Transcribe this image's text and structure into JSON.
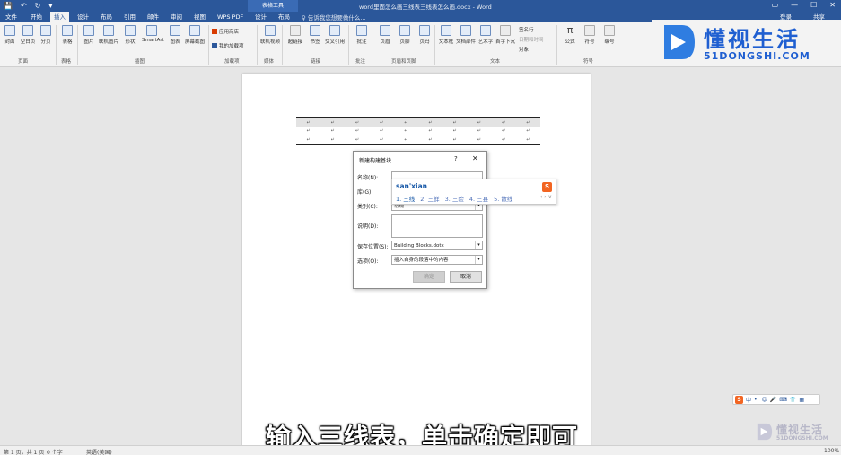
{
  "titlebar": {
    "quick_access": [
      "💾",
      "↶",
      "↻",
      "▾"
    ],
    "context_tab": "表格工具",
    "document_title": "word里面怎么画三线表三线表怎么画.docx - Word",
    "window_buttons": [
      "▭",
      "—",
      "☐",
      "✕"
    ]
  },
  "tabs": {
    "items": [
      "文件",
      "开始",
      "插入",
      "设计",
      "布局",
      "引用",
      "邮件",
      "审阅",
      "视图",
      "WPS PDF",
      "设计",
      "布局"
    ],
    "active_index": 2,
    "tell_me": "♀ 告诉我您想要做什么...",
    "user": "登录",
    "share": "共享"
  },
  "ribbon": {
    "buttons": [
      "封面",
      "空白页",
      "分页",
      "表格",
      "图片",
      "联机图片",
      "形状",
      "SmartArt",
      "图表",
      "屏幕截图",
      "联机视频",
      "超链接",
      "书签",
      "交叉引用",
      "批注",
      "页眉",
      "页脚",
      "页码",
      "文本框",
      "文档部件",
      "艺术字",
      "首字下沉",
      "公式",
      "符号",
      "编号"
    ],
    "small_items": [
      "应用商店",
      "我的加载项",
      "签名行",
      "日期和时间",
      "对象"
    ],
    "groups": [
      "页面",
      "表格",
      "插图",
      "加载项",
      "媒体",
      "链接",
      "批注",
      "页眉和页脚",
      "文本",
      "符号"
    ]
  },
  "watermark": {
    "brand_cn": "懂视生活",
    "brand_en": "51DONGSHI.COM"
  },
  "document": {
    "cell_mark": "↵",
    "rows": 3,
    "cols": 10
  },
  "dialog": {
    "title": "新建构建基块",
    "help": "?",
    "close": "✕",
    "fields": {
      "name_label": "名称(N):",
      "gallery_label": "库(G):",
      "category_label": "类别(C):",
      "category_value": "常规",
      "description_label": "说明(D):",
      "save_in_label": "保存位置(S):",
      "save_in_value": "Building Blocks.dotx",
      "options_label": "选项(O):",
      "options_value": "插入自身的段落中的内容"
    },
    "ok_label": "确定",
    "cancel_label": "取消"
  },
  "ime": {
    "pinyin": "san'xian",
    "candidates": [
      "1. 三线",
      "2. 三鲜",
      "3. 三险",
      "4. 三县",
      "5. 散线"
    ],
    "nav": "‹ › ∨",
    "logo": "S"
  },
  "sogou_bar": {
    "logo": "S",
    "items": [
      "中",
      "•,",
      "☺",
      "🎤",
      "⌨",
      "👕",
      "▦"
    ]
  },
  "caption": "输入三线表，单击确定即可",
  "statusbar": {
    "page": "第 1 页，共 1 页",
    "words": "0 个字",
    "lang": "英语(美国)",
    "zoom": "100%"
  }
}
